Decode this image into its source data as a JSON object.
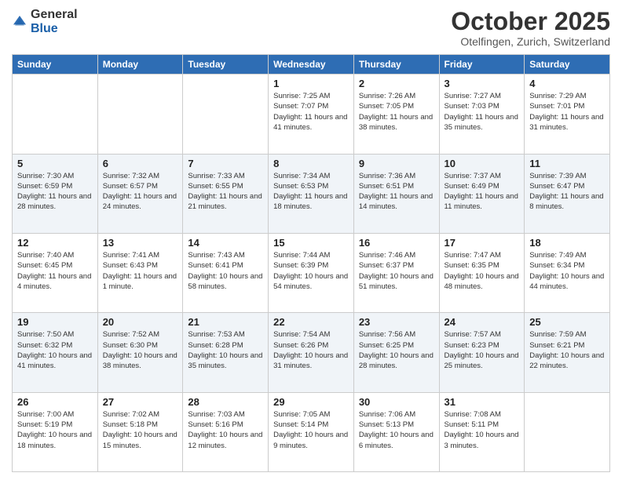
{
  "header": {
    "logo_general": "General",
    "logo_blue": "Blue",
    "month": "October 2025",
    "location": "Otelfingen, Zurich, Switzerland"
  },
  "weekdays": [
    "Sunday",
    "Monday",
    "Tuesday",
    "Wednesday",
    "Thursday",
    "Friday",
    "Saturday"
  ],
  "rows": [
    [
      {
        "day": "",
        "info": ""
      },
      {
        "day": "",
        "info": ""
      },
      {
        "day": "",
        "info": ""
      },
      {
        "day": "1",
        "info": "Sunrise: 7:25 AM\nSunset: 7:07 PM\nDaylight: 11 hours and 41 minutes."
      },
      {
        "day": "2",
        "info": "Sunrise: 7:26 AM\nSunset: 7:05 PM\nDaylight: 11 hours and 38 minutes."
      },
      {
        "day": "3",
        "info": "Sunrise: 7:27 AM\nSunset: 7:03 PM\nDaylight: 11 hours and 35 minutes."
      },
      {
        "day": "4",
        "info": "Sunrise: 7:29 AM\nSunset: 7:01 PM\nDaylight: 11 hours and 31 minutes."
      }
    ],
    [
      {
        "day": "5",
        "info": "Sunrise: 7:30 AM\nSunset: 6:59 PM\nDaylight: 11 hours and 28 minutes."
      },
      {
        "day": "6",
        "info": "Sunrise: 7:32 AM\nSunset: 6:57 PM\nDaylight: 11 hours and 24 minutes."
      },
      {
        "day": "7",
        "info": "Sunrise: 7:33 AM\nSunset: 6:55 PM\nDaylight: 11 hours and 21 minutes."
      },
      {
        "day": "8",
        "info": "Sunrise: 7:34 AM\nSunset: 6:53 PM\nDaylight: 11 hours and 18 minutes."
      },
      {
        "day": "9",
        "info": "Sunrise: 7:36 AM\nSunset: 6:51 PM\nDaylight: 11 hours and 14 minutes."
      },
      {
        "day": "10",
        "info": "Sunrise: 7:37 AM\nSunset: 6:49 PM\nDaylight: 11 hours and 11 minutes."
      },
      {
        "day": "11",
        "info": "Sunrise: 7:39 AM\nSunset: 6:47 PM\nDaylight: 11 hours and 8 minutes."
      }
    ],
    [
      {
        "day": "12",
        "info": "Sunrise: 7:40 AM\nSunset: 6:45 PM\nDaylight: 11 hours and 4 minutes."
      },
      {
        "day": "13",
        "info": "Sunrise: 7:41 AM\nSunset: 6:43 PM\nDaylight: 11 hours and 1 minute."
      },
      {
        "day": "14",
        "info": "Sunrise: 7:43 AM\nSunset: 6:41 PM\nDaylight: 10 hours and 58 minutes."
      },
      {
        "day": "15",
        "info": "Sunrise: 7:44 AM\nSunset: 6:39 PM\nDaylight: 10 hours and 54 minutes."
      },
      {
        "day": "16",
        "info": "Sunrise: 7:46 AM\nSunset: 6:37 PM\nDaylight: 10 hours and 51 minutes."
      },
      {
        "day": "17",
        "info": "Sunrise: 7:47 AM\nSunset: 6:35 PM\nDaylight: 10 hours and 48 minutes."
      },
      {
        "day": "18",
        "info": "Sunrise: 7:49 AM\nSunset: 6:34 PM\nDaylight: 10 hours and 44 minutes."
      }
    ],
    [
      {
        "day": "19",
        "info": "Sunrise: 7:50 AM\nSunset: 6:32 PM\nDaylight: 10 hours and 41 minutes."
      },
      {
        "day": "20",
        "info": "Sunrise: 7:52 AM\nSunset: 6:30 PM\nDaylight: 10 hours and 38 minutes."
      },
      {
        "day": "21",
        "info": "Sunrise: 7:53 AM\nSunset: 6:28 PM\nDaylight: 10 hours and 35 minutes."
      },
      {
        "day": "22",
        "info": "Sunrise: 7:54 AM\nSunset: 6:26 PM\nDaylight: 10 hours and 31 minutes."
      },
      {
        "day": "23",
        "info": "Sunrise: 7:56 AM\nSunset: 6:25 PM\nDaylight: 10 hours and 28 minutes."
      },
      {
        "day": "24",
        "info": "Sunrise: 7:57 AM\nSunset: 6:23 PM\nDaylight: 10 hours and 25 minutes."
      },
      {
        "day": "25",
        "info": "Sunrise: 7:59 AM\nSunset: 6:21 PM\nDaylight: 10 hours and 22 minutes."
      }
    ],
    [
      {
        "day": "26",
        "info": "Sunrise: 7:00 AM\nSunset: 5:19 PM\nDaylight: 10 hours and 18 minutes."
      },
      {
        "day": "27",
        "info": "Sunrise: 7:02 AM\nSunset: 5:18 PM\nDaylight: 10 hours and 15 minutes."
      },
      {
        "day": "28",
        "info": "Sunrise: 7:03 AM\nSunset: 5:16 PM\nDaylight: 10 hours and 12 minutes."
      },
      {
        "day": "29",
        "info": "Sunrise: 7:05 AM\nSunset: 5:14 PM\nDaylight: 10 hours and 9 minutes."
      },
      {
        "day": "30",
        "info": "Sunrise: 7:06 AM\nSunset: 5:13 PM\nDaylight: 10 hours and 6 minutes."
      },
      {
        "day": "31",
        "info": "Sunrise: 7:08 AM\nSunset: 5:11 PM\nDaylight: 10 hours and 3 minutes."
      },
      {
        "day": "",
        "info": ""
      }
    ]
  ]
}
